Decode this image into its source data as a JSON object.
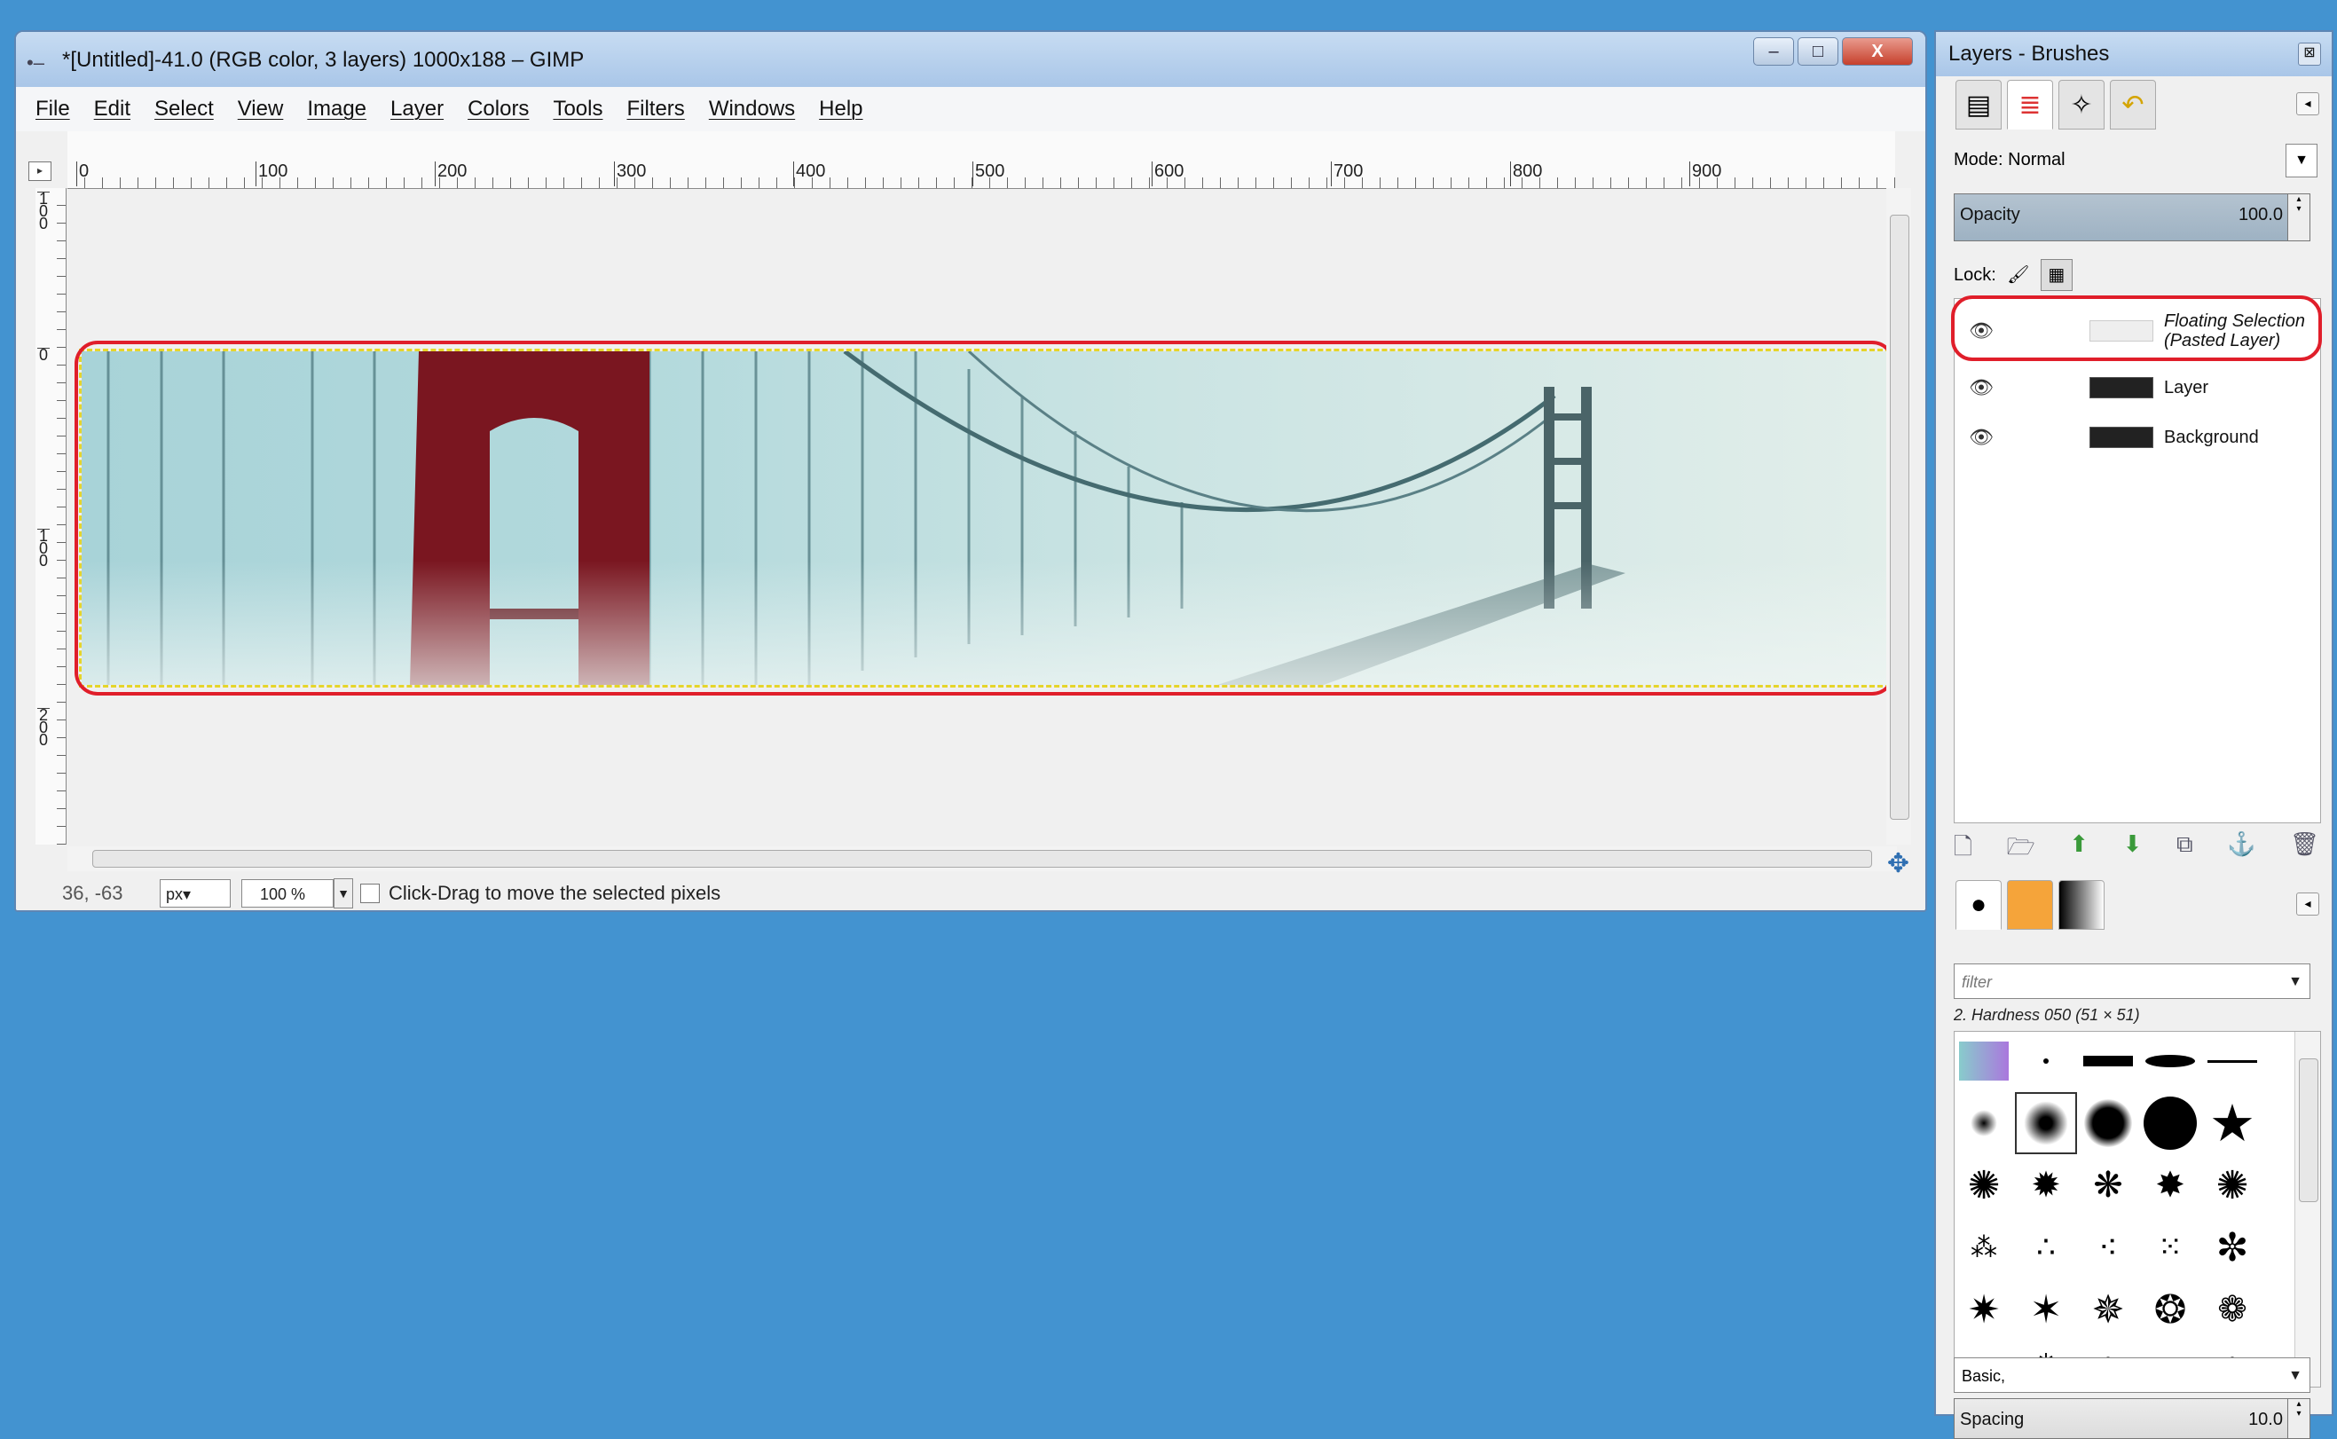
{
  "main_window": {
    "title": "*[Untitled]-41.0 (RGB color, 3 layers) 1000x188 – GIMP",
    "buttons": {
      "minimize": "–",
      "maximize": "□",
      "close": "X"
    },
    "menu": [
      "File",
      "Edit",
      "Select",
      "View",
      "Image",
      "Layer",
      "Colors",
      "Tools",
      "Filters",
      "Windows",
      "Help"
    ],
    "ruler_top_labels": [
      "0",
      "100",
      "200",
      "300",
      "400",
      "500",
      "600",
      "700",
      "800",
      "900"
    ],
    "ruler_left_labels": [
      "100",
      "0",
      "100",
      "200"
    ],
    "status": {
      "coords": "36, -63",
      "unit": "px▾",
      "zoom": "100 %",
      "message": "Click-Drag to move the selected pixels"
    }
  },
  "dock": {
    "title": "Layers - Brushes",
    "mode_label": "Mode:",
    "mode_value": "Normal",
    "opacity_label": "Opacity",
    "opacity_value": "100.0",
    "lock_label": "Lock:",
    "layers": [
      {
        "name_line1": "Floating Selection",
        "name_line2": "(Pasted Layer)",
        "visible": true
      },
      {
        "name": "Layer",
        "visible": true
      },
      {
        "name": "Background",
        "visible": true
      }
    ],
    "brush_filter_placeholder": "filter",
    "brush_name": "2. Hardness 050 (51 × 51)",
    "brush_preset": "Basic,",
    "spacing_label": "Spacing",
    "spacing_value": "10.0"
  },
  "colors": {
    "desktop": "#4393d0",
    "highlight": "#e01e2a",
    "bridge": "#7a1620"
  }
}
